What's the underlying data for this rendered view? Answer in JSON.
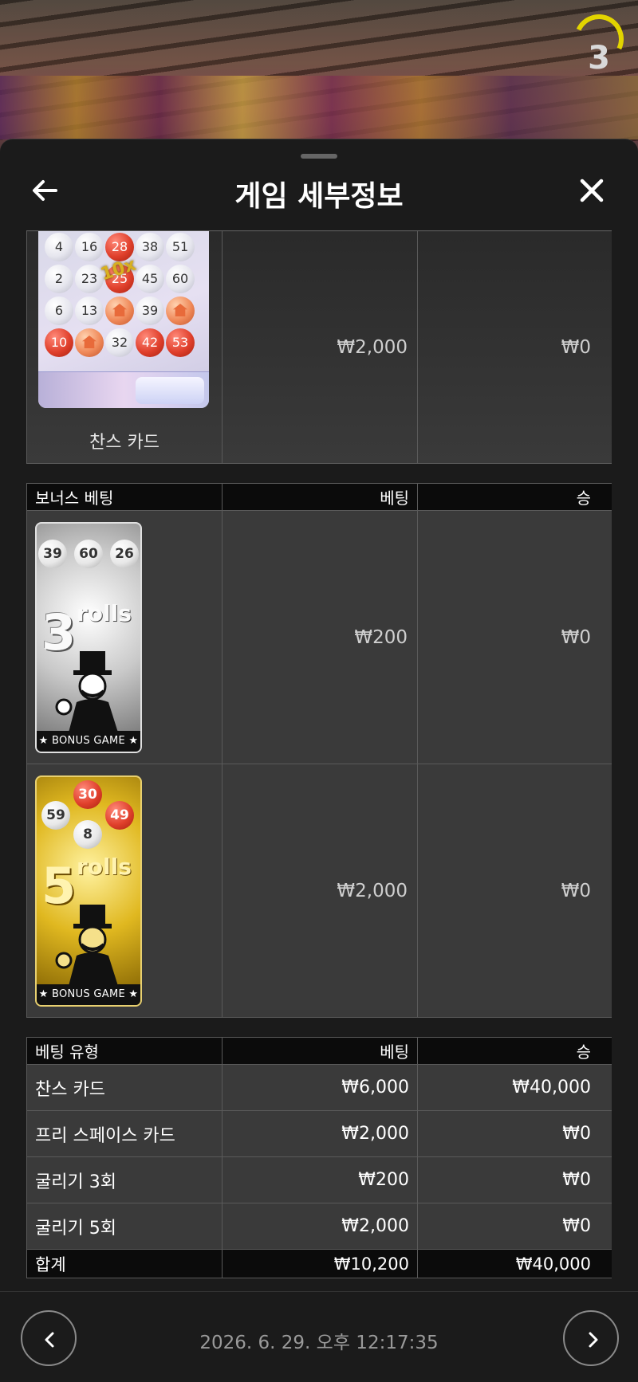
{
  "timer": {
    "value": "3"
  },
  "header": {
    "title": "게임 세부정보"
  },
  "chance_card_row": {
    "label": "찬스 카드",
    "bet": "₩2,000",
    "win": "₩0",
    "multiplier": "10x",
    "balls": [
      "4",
      "16",
      "28",
      "38",
      "51",
      "2",
      "23",
      "25",
      "45",
      "60",
      "6",
      "13",
      "39",
      "10",
      "32",
      "42",
      "53"
    ]
  },
  "bonus_table": {
    "headers": {
      "type": "보너스 베팅",
      "bet": "베팅",
      "win": "승"
    },
    "rows": [
      {
        "card_big": "3",
        "card_rolls": "rolls",
        "card_strip": "★ BONUS GAME ★",
        "balls": [
          "39",
          "60",
          "26"
        ],
        "bet": "₩200",
        "win": "₩0"
      },
      {
        "card_big": "5",
        "card_rolls": "rolls",
        "card_strip": "★ BONUS GAME ★",
        "balls": [
          "30",
          "59",
          "49",
          "8"
        ],
        "bet": "₩2,000",
        "win": "₩0"
      }
    ]
  },
  "summary_table": {
    "headers": {
      "type": "베팅 유형",
      "bet": "베팅",
      "win": "승"
    },
    "rows": [
      {
        "type": "찬스 카드",
        "bet": "₩6,000",
        "win": "₩40,000"
      },
      {
        "type": "프리 스페이스 카드",
        "bet": "₩2,000",
        "win": "₩0"
      },
      {
        "type": "굴리기 3회",
        "bet": "₩200",
        "win": "₩0"
      },
      {
        "type": "굴리기 5회",
        "bet": "₩2,000",
        "win": "₩0"
      }
    ],
    "total": {
      "label": "합계",
      "bet": "₩10,200",
      "win": "₩40,000"
    }
  },
  "footer": {
    "timestamp": "2026. 6. 29. 오후 12:17:35"
  },
  "colors": {
    "background": "#1b1b1b",
    "header_row": "#0b0b0b",
    "row": "#3a3a3a",
    "timer_accent": "#e3d400"
  }
}
